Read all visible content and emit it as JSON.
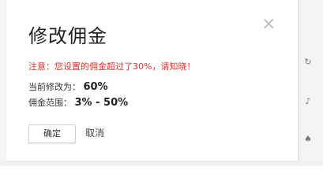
{
  "dialog": {
    "title": "修改佣金",
    "close_icon": "close-icon",
    "warning": "注意：您设置的佣金超过了30%，请知晓！",
    "current_label": "当前修改为：",
    "current_value": "60%",
    "range_label": "佣金范围：",
    "range_value": "3% - 50%",
    "confirm_label": "确定",
    "cancel_label": "取消"
  },
  "colors": {
    "warning": "#e0302c",
    "close": "#bdbdbd"
  }
}
